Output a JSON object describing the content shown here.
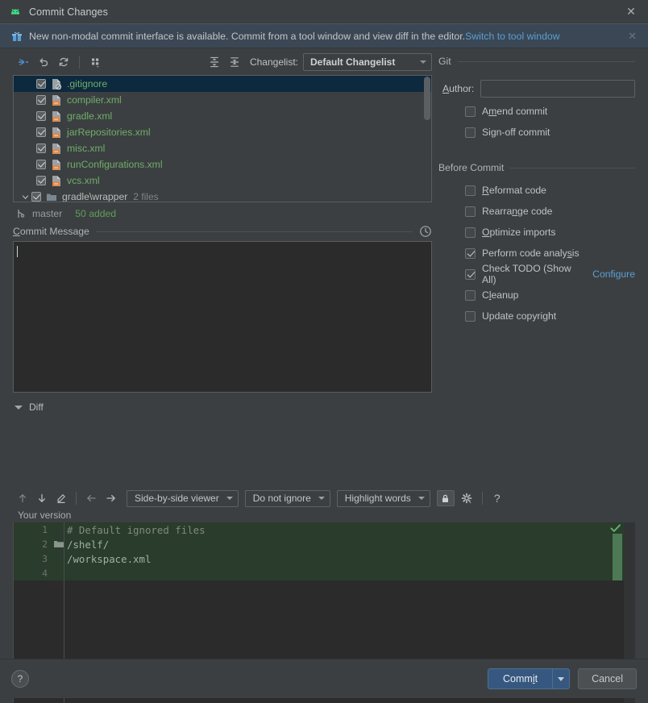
{
  "window": {
    "title": "Commit Changes",
    "icon": "android-studio-icon",
    "close_label": "✕"
  },
  "banner": {
    "icon": "gift-icon",
    "text": "New non-modal commit interface is available. Commit from a tool window and view diff in the editor.",
    "link": "Switch to tool window",
    "close_label": "✕"
  },
  "filelist_toolbar": {
    "buttons": [
      {
        "name": "shelve-silently-icon",
        "tip": "Shelve Silently"
      },
      {
        "name": "revert-icon",
        "tip": "Revert"
      },
      {
        "name": "refresh-icon",
        "tip": "Refresh"
      },
      {
        "name": "group-by-icon",
        "tip": "Group By"
      },
      {
        "name": "expand-all-icon",
        "tip": "Expand All"
      },
      {
        "name": "collapse-all-icon",
        "tip": "Collapse All"
      }
    ],
    "changelist_label": "Changelist:",
    "changelist_value": "Default Changelist"
  },
  "files": [
    {
      "name": ".gitignore",
      "icon": "gitignore-file-icon",
      "checked": true,
      "selected": true,
      "type": "file"
    },
    {
      "name": "compiler.xml",
      "icon": "xml-file-icon",
      "checked": true,
      "selected": false,
      "type": "file"
    },
    {
      "name": "gradle.xml",
      "icon": "xml-file-icon",
      "checked": true,
      "selected": false,
      "type": "file"
    },
    {
      "name": "jarRepositories.xml",
      "icon": "xml-file-icon",
      "checked": true,
      "selected": false,
      "type": "file"
    },
    {
      "name": "misc.xml",
      "icon": "xml-file-icon",
      "checked": true,
      "selected": false,
      "type": "file"
    },
    {
      "name": "runConfigurations.xml",
      "icon": "xml-file-icon",
      "checked": true,
      "selected": false,
      "type": "file"
    },
    {
      "name": "vcs.xml",
      "icon": "xml-file-icon",
      "checked": true,
      "selected": false,
      "type": "file"
    },
    {
      "name": "gradle\\wrapper",
      "icon": "folder-icon",
      "checked": true,
      "selected": false,
      "type": "dir",
      "count": "2 files"
    }
  ],
  "status": {
    "branch_icon": "git-branch-icon",
    "branch": "master",
    "added": "50 added"
  },
  "commit_message": {
    "label": "Commit Message",
    "label_mnemonic": "C",
    "value": "",
    "history_icon": "clock-history-icon"
  },
  "diff_section": {
    "label": "Diff",
    "toolbar": {
      "prev_diff_icon": "arrow-up-icon",
      "next_diff_icon": "arrow-down-icon",
      "edit_icon": "pencil-icon",
      "accept_left_icon": "arrow-left-icon",
      "accept_right_icon": "arrow-right-icon",
      "viewer_mode": "Side-by-side viewer",
      "whitespace_mode": "Do not ignore",
      "highlight_mode": "Highlight words",
      "lock_icon": "lock-icon",
      "settings_icon": "gear-icon",
      "help_icon": "question-mark-icon"
    },
    "pane_title": "Your version",
    "lines": [
      {
        "num": "1",
        "text": "# Default ignored files",
        "kind": "comment",
        "folder": false
      },
      {
        "num": "2",
        "text": "/shelf/",
        "kind": "text",
        "folder": true
      },
      {
        "num": "3",
        "text": "/workspace.xml",
        "kind": "text",
        "folder": false
      },
      {
        "num": "4",
        "text": "",
        "kind": "text",
        "folder": false
      }
    ],
    "status_check": "✓"
  },
  "git_section": {
    "label": "Git",
    "author_label": "Author:",
    "author_mnemonic": "A",
    "author_value": "",
    "options": [
      {
        "label": "Amend commit",
        "checked": false,
        "mnemonic_index": 1
      },
      {
        "label": "Sign-off commit",
        "checked": false,
        "mnemonic_index": 2
      }
    ]
  },
  "before_commit": {
    "label": "Before Commit",
    "options": [
      {
        "label": "Reformat code",
        "checked": false,
        "link": null
      },
      {
        "label": "Rearrange code",
        "checked": false,
        "link": null
      },
      {
        "label": "Optimize imports",
        "checked": false,
        "link": null
      },
      {
        "label": "Perform code analysis",
        "checked": true,
        "link": null
      },
      {
        "label": "Check TODO (Show All)",
        "checked": true,
        "link": "Configure"
      },
      {
        "label": "Cleanup",
        "checked": false,
        "link": null
      },
      {
        "label": "Update copyright",
        "checked": false,
        "link": null
      }
    ]
  },
  "footer": {
    "help_label": "?",
    "commit_label": "Commit",
    "cancel_label": "Cancel"
  },
  "colors": {
    "background": "#3c3f41",
    "banner_bg": "#3b4754",
    "link": "#5a9fd4",
    "added_green": "#5f9e59",
    "file_green": "#6fae69",
    "selection_blue": "#0d293e",
    "primary_button": "#365880",
    "diff_added_bg": "#2a3c2c"
  }
}
